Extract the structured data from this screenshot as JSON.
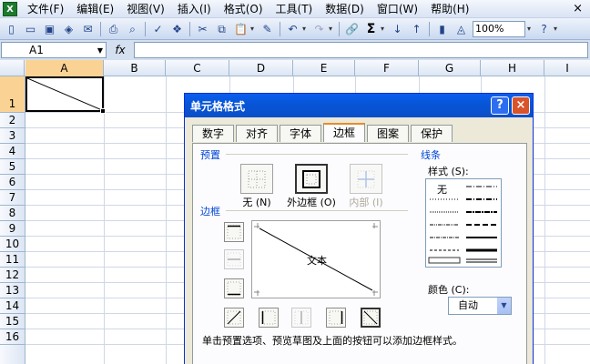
{
  "menubar": {
    "app_icon": "excel-icon",
    "items": [
      "文件(F)",
      "编辑(E)",
      "视图(V)",
      "插入(I)",
      "格式(O)",
      "工具(T)",
      "数据(D)",
      "窗口(W)",
      "帮助(H)"
    ],
    "close": "×"
  },
  "toolbar": {
    "zoom": "100%"
  },
  "formula_bar": {
    "name_box": "A1",
    "fx": "fx",
    "value": ""
  },
  "grid": {
    "columns": [
      "A",
      "B",
      "C",
      "D",
      "E",
      "F",
      "G",
      "H",
      "I"
    ],
    "rows": [
      "1",
      "2",
      "3",
      "4",
      "5",
      "6",
      "7",
      "8",
      "9",
      "10",
      "11",
      "12",
      "13",
      "14",
      "15",
      "16"
    ],
    "active_cell": "A1"
  },
  "dialog": {
    "title": "单元格格式",
    "help": "?",
    "close": "×",
    "tabs": [
      "数字",
      "对齐",
      "字体",
      "边框",
      "图案",
      "保护"
    ],
    "active_tab": "边框",
    "presets_label": "预置",
    "presets": [
      {
        "label": "无 (N)",
        "enabled": true
      },
      {
        "label": "外边框 (O)",
        "enabled": true
      },
      {
        "label": "内部 (I)",
        "enabled": false
      }
    ],
    "border_label": "边框",
    "preview_text": "文本",
    "line_label": "线条",
    "style_label": "样式 (S):",
    "style_none": "无",
    "color_label": "颜色 (C):",
    "color_value": "自动",
    "hint": "单击预置选项、预览草图及上面的按钮可以添加边框样式。"
  }
}
